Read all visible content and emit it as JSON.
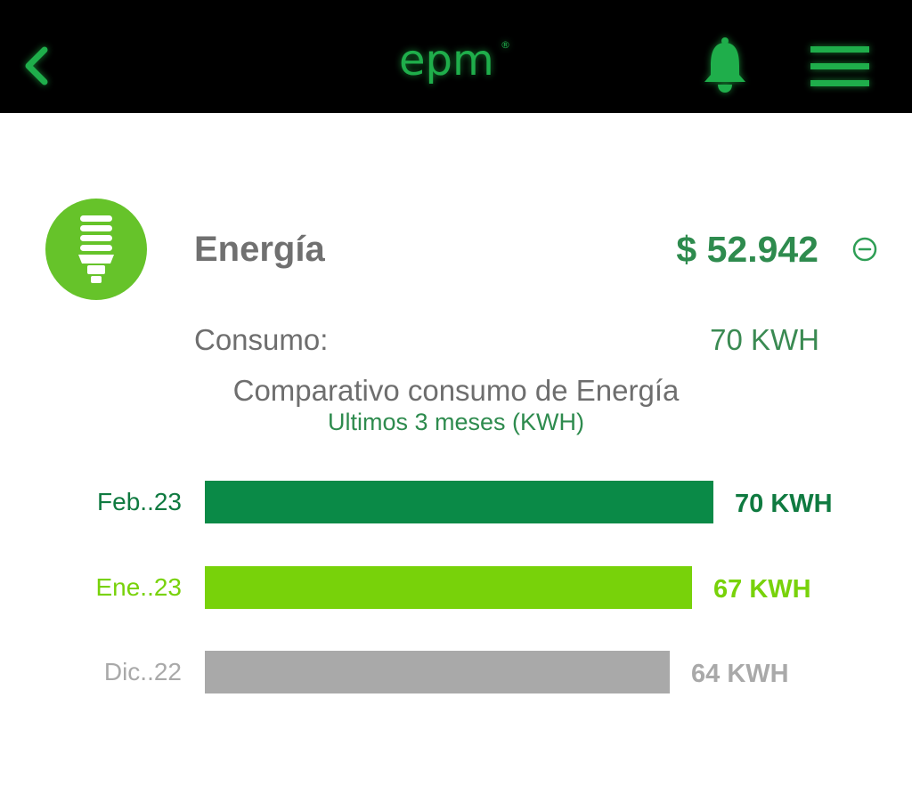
{
  "header": {
    "back_icon": "chevron-left-icon",
    "logo_text": "epm",
    "logo_registered": "®",
    "bell_icon": "bell-icon",
    "menu_icon": "hamburger-menu-icon",
    "accent_color": "#1fae4b",
    "background_color": "#000000"
  },
  "service": {
    "icon": "lightbulb-icon",
    "icon_color": "#66c32a",
    "title": "Energía",
    "amount": "$ 52.942",
    "collapse_icon": "minus-circle-icon",
    "consumo_label": "Consumo:",
    "consumo_value": "70 KWH"
  },
  "chart": {
    "title": "Comparativo consumo de Energía",
    "subtitle": "Ultimos 3 meses (KWH)"
  },
  "chart_data": {
    "type": "bar",
    "orientation": "horizontal",
    "title": "Comparativo consumo de Energía",
    "subtitle": "Ultimos 3 meses (KWH)",
    "categories": [
      "Feb..23",
      "Ene..23",
      "Dic..22"
    ],
    "values": [
      70,
      67,
      64
    ],
    "value_labels": [
      "70 KWH",
      "67 KWH",
      "64 KWH"
    ],
    "colors": [
      "#0a8a47",
      "#78d20a",
      "#a9a9a9"
    ],
    "label_colors": [
      "#0f7a40",
      "#78d20a",
      "#a9a9a9"
    ],
    "grid": false,
    "xlim": [
      0,
      70
    ]
  }
}
